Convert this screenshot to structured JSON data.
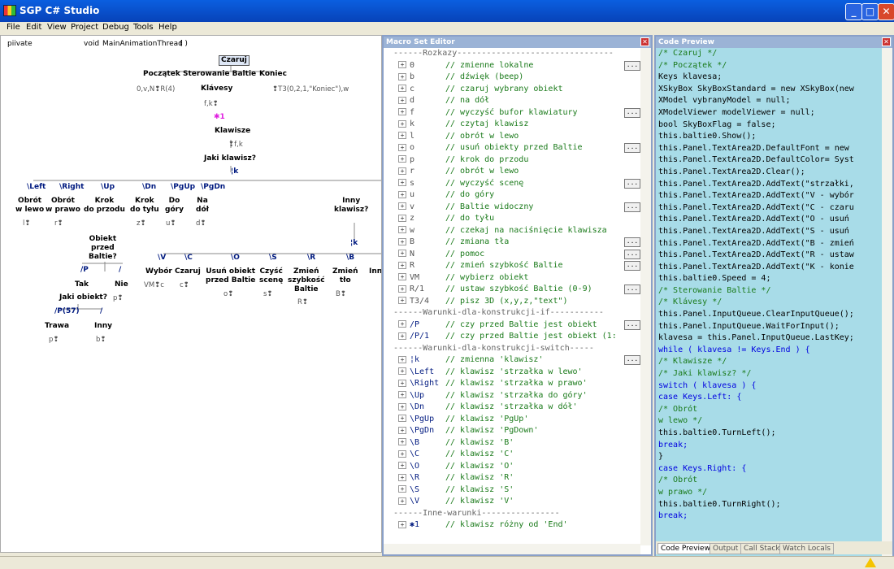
{
  "window": {
    "title": "SGP C# Studio",
    "min": "_",
    "max": "□",
    "close": "✕"
  },
  "menu": [
    "File",
    "Edit",
    "View",
    "Project",
    "Debug",
    "Tools",
    "Help"
  ],
  "diagram": {
    "header": {
      "visibility": "piivate",
      "type": "void",
      "name": "MainAnimationThread",
      "parens": "(        )"
    },
    "nodes": [
      {
        "id": "czaruj",
        "text": "Czaruj",
        "style": "nb"
      },
      {
        "id": "poczatek",
        "text": "Początek",
        "style": "nb"
      },
      {
        "id": "sterowanie",
        "text": "Sterowanie Baltie",
        "style": "nb"
      },
      {
        "id": "koniec",
        "text": "Koniec",
        "style": "nb"
      },
      {
        "id": "g-poczatek",
        "text": "0,v,N❢R(4)",
        "style": "ng"
      },
      {
        "id": "klavesy",
        "text": "Klávesy",
        "style": "nb"
      },
      {
        "id": "g-koniec",
        "text": "❢T3(0,2,1,\"Koniec\"),w",
        "style": "ng"
      },
      {
        "id": "g-fk",
        "text": "f,k❢",
        "style": "ng"
      },
      {
        "id": "m1",
        "text": "✱1",
        "style": "nm"
      },
      {
        "id": "klawisze",
        "text": "Klawisze",
        "style": "nb"
      },
      {
        "id": "g-fk2",
        "text": "❢f,k",
        "style": "ng"
      },
      {
        "id": "jaki-klawisz",
        "text": "Jaki klawisz?",
        "style": "nb"
      },
      {
        "id": "k-var",
        "text": "¦k",
        "style": "nl"
      },
      {
        "id": "c-left",
        "text": "\\Left",
        "style": "nl"
      },
      {
        "id": "c-right",
        "text": "\\Right",
        "style": "nl"
      },
      {
        "id": "c-up",
        "text": "\\Up",
        "style": "nl"
      },
      {
        "id": "c-dn",
        "text": "\\Dn",
        "style": "nl"
      },
      {
        "id": "c-pgup",
        "text": "\\PgUp",
        "style": "nl"
      },
      {
        "id": "c-pgdn",
        "text": "\\PgDn",
        "style": "nl"
      },
      {
        "id": "a-obrot-l",
        "text": "Obrót\nw lewo",
        "style": "nb"
      },
      {
        "id": "a-obrot-p",
        "text": "Obrót\nw prawo",
        "style": "nb"
      },
      {
        "id": "a-krok-p",
        "text": "Krok\ndo przodu",
        "style": "nb"
      },
      {
        "id": "a-krok-t",
        "text": "Krok\ndo tyłu",
        "style": "nb"
      },
      {
        "id": "a-do-gory",
        "text": "Do\ngóry",
        "style": "nb"
      },
      {
        "id": "a-na-dol",
        "text": "Na\ndół",
        "style": "nb"
      },
      {
        "id": "a-inny",
        "text": "Inny\nklawisz?",
        "style": "nb"
      },
      {
        "id": "g-l",
        "text": "l❢",
        "style": "ng"
      },
      {
        "id": "g-r",
        "text": "r❢",
        "style": "ng"
      },
      {
        "id": "g-z",
        "text": "z❢",
        "style": "ng"
      },
      {
        "id": "g-u",
        "text": "u❢",
        "style": "ng"
      },
      {
        "id": "g-d",
        "text": "d❢",
        "style": "ng"
      },
      {
        "id": "obiekt-q",
        "text": "Obiekt\nprzed\nBaltie?",
        "style": "nb"
      },
      {
        "id": "k-var2",
        "text": "¦k",
        "style": "nl"
      },
      {
        "id": "c-p",
        "text": "/P",
        "style": "nl"
      },
      {
        "id": "c-slash",
        "text": "/",
        "style": "nl"
      },
      {
        "id": "c-v",
        "text": "\\V",
        "style": "nl"
      },
      {
        "id": "c-c",
        "text": "\\C",
        "style": "nl"
      },
      {
        "id": "c-o",
        "text": "\\O",
        "style": "nl"
      },
      {
        "id": "c-s",
        "text": "\\S",
        "style": "nl"
      },
      {
        "id": "c-r",
        "text": "\\R",
        "style": "nl"
      },
      {
        "id": "c-b",
        "text": "\\B",
        "style": "nl"
      },
      {
        "id": "tak",
        "text": "Tak",
        "style": "nb"
      },
      {
        "id": "nie",
        "text": "Nie",
        "style": "nb"
      },
      {
        "id": "jaki-obiekt",
        "text": "Jaki obiekt?",
        "style": "nb"
      },
      {
        "id": "g-p",
        "text": "p❢",
        "style": "ng"
      },
      {
        "id": "a-wybor",
        "text": "Wybór",
        "style": "nb"
      },
      {
        "id": "a-czaruj",
        "text": "Czaruj",
        "style": "nb"
      },
      {
        "id": "a-usun",
        "text": "Usuń obiekt\nprzed Baltie",
        "style": "nb"
      },
      {
        "id": "a-czysc",
        "text": "Czyść\nscenę",
        "style": "nb"
      },
      {
        "id": "a-zmien-s",
        "text": "Zmień\nszybkość\nBaltie",
        "style": "nb"
      },
      {
        "id": "a-zmien-t",
        "text": "Zmień\ntło",
        "style": "nb"
      },
      {
        "id": "a-inn",
        "text": "Inny",
        "style": "nb"
      },
      {
        "id": "g-vm",
        "text": "VM❢c",
        "style": "ng"
      },
      {
        "id": "g-c",
        "text": "c❢",
        "style": "ng"
      },
      {
        "id": "g-o",
        "text": "o❢",
        "style": "ng"
      },
      {
        "id": "g-s",
        "text": "s❢",
        "style": "ng"
      },
      {
        "id": "g-R",
        "text": "R❢",
        "style": "ng"
      },
      {
        "id": "g-B",
        "text": "B❢",
        "style": "ng"
      },
      {
        "id": "c-p57",
        "text": "/P(57)",
        "style": "nl"
      },
      {
        "id": "c-slash2",
        "text": "/",
        "style": "nl"
      },
      {
        "id": "trawa",
        "text": "Trawa",
        "style": "nb"
      },
      {
        "id": "inny2",
        "text": "Inny",
        "style": "nb"
      },
      {
        "id": "g-p2",
        "text": "p❢",
        "style": "ng"
      },
      {
        "id": "g-b2",
        "text": "b❢",
        "style": "ng"
      }
    ]
  },
  "macro_editor": {
    "title": "Macro Set Editor",
    "rows": [
      {
        "t": "sec",
        "text": "------Rozkazy--------------------------------"
      },
      {
        "t": "row",
        "key": "0",
        "comment": "// zmienne lokalne",
        "dots": true
      },
      {
        "t": "row",
        "key": "b",
        "comment": "// dźwięk (beep)"
      },
      {
        "t": "row",
        "key": "c",
        "comment": "// czaruj wybrany obiekt"
      },
      {
        "t": "row",
        "key": "d",
        "comment": "// na dół"
      },
      {
        "t": "row",
        "key": "f",
        "comment": "// wyczyść bufor klawiatury",
        "dots": true
      },
      {
        "t": "row",
        "key": "k",
        "comment": "// czytaj klawisz"
      },
      {
        "t": "row",
        "key": "l",
        "comment": "// obrót w lewo"
      },
      {
        "t": "row",
        "key": "o",
        "comment": "// usuń obiekty przed Baltie",
        "dots": true
      },
      {
        "t": "row",
        "key": "p",
        "comment": "// krok do przodu"
      },
      {
        "t": "row",
        "key": "r",
        "comment": "// obrót w lewo"
      },
      {
        "t": "row",
        "key": "s",
        "comment": "// wyczyść scenę",
        "dots": true
      },
      {
        "t": "row",
        "key": "u",
        "comment": "// do góry"
      },
      {
        "t": "row",
        "key": "v",
        "comment": "// Baltie widoczny",
        "dots": true
      },
      {
        "t": "row",
        "key": "z",
        "comment": "// do tyłu"
      },
      {
        "t": "row",
        "key": "w",
        "comment": "// czekaj na naciśnięcie klawisza"
      },
      {
        "t": "row",
        "key": "B",
        "comment": "// zmiana tła",
        "dots": true
      },
      {
        "t": "row",
        "key": "N",
        "comment": "// pomoc",
        "dots": true
      },
      {
        "t": "row",
        "key": "R",
        "comment": "// zmień szybkość Baltie",
        "dots": true
      },
      {
        "t": "row",
        "key": "VM",
        "comment": "// wybierz obiekt"
      },
      {
        "t": "row",
        "key": "R/1",
        "comment": "// ustaw szybkość Baltie (0-9)",
        "dots": true
      },
      {
        "t": "row",
        "key": "T3/4",
        "comment": "// pisz 3D (x,y,z,\"text\")"
      },
      {
        "t": "sec",
        "text": "------Warunki-dla-konstrukcji-if-----------"
      },
      {
        "t": "row",
        "key": "/P",
        "blue": true,
        "comment": "// czy przed Baltie jest obiekt",
        "dots": true
      },
      {
        "t": "row",
        "key": "/P/1",
        "blue": true,
        "comment": "// czy przed Baltie jest obiekt (1:"
      },
      {
        "t": "sec",
        "text": "------Warunki-dla-konstrukcji-switch-----"
      },
      {
        "t": "row",
        "key": "¦k",
        "blue": true,
        "comment": "// zmienna 'klawisz'",
        "dots": true
      },
      {
        "t": "row",
        "key": "\\Left",
        "blue": true,
        "comment": "// klawisz 'strzałka w lewo'"
      },
      {
        "t": "row",
        "key": "\\Right",
        "blue": true,
        "comment": "// klawisz 'strzałka w prawo'"
      },
      {
        "t": "row",
        "key": "\\Up",
        "blue": true,
        "comment": "// klawisz 'strzałka do góry'"
      },
      {
        "t": "row",
        "key": "\\Dn",
        "blue": true,
        "comment": "// klawisz 'strzałka w dół'"
      },
      {
        "t": "row",
        "key": "\\PgUp",
        "blue": true,
        "comment": "// klawisz 'PgUp'"
      },
      {
        "t": "row",
        "key": "\\PgDn",
        "blue": true,
        "comment": "// klawisz 'PgDown'"
      },
      {
        "t": "row",
        "key": "\\B",
        "blue": true,
        "comment": "// klawisz 'B'"
      },
      {
        "t": "row",
        "key": "\\C",
        "blue": true,
        "comment": "// klawisz 'C'"
      },
      {
        "t": "row",
        "key": "\\O",
        "blue": true,
        "comment": "// klawisz 'O'"
      },
      {
        "t": "row",
        "key": "\\R",
        "blue": true,
        "comment": "// klawisz 'R'"
      },
      {
        "t": "row",
        "key": "\\S",
        "blue": true,
        "comment": "// klawisz 'S'"
      },
      {
        "t": "row",
        "key": "\\V",
        "blue": true,
        "comment": "// klawisz 'V'"
      },
      {
        "t": "sec",
        "text": "------Inne-warunki----------------"
      },
      {
        "t": "row",
        "key": "✱1",
        "blue": true,
        "comment": "// klawisz różny od 'End'"
      }
    ]
  },
  "code_preview": {
    "title": "Code Preview",
    "lines": [
      {
        "c": "ccm",
        "text": "/* Czaruj */"
      },
      {
        "c": "ccm",
        "text": "/* Początek */"
      },
      {
        "c": "ctx",
        "text": "Keys klavesa;"
      },
      {
        "c": "ctx",
        "text": "XSkyBox SkyBoxStandard = new XSkyBox(new"
      },
      {
        "c": "ctx",
        "text": "XModel vybranyModel = null;"
      },
      {
        "c": "ctx",
        "text": "XModelViewer modelViewer = null;"
      },
      {
        "c": "ctx",
        "text": "bool SkyBoxFlag = false;"
      },
      {
        "c": "ctx",
        "text": "this.baltie0.Show();"
      },
      {
        "c": "ctx",
        "text": "this.Panel.TextArea2D.DefaultFont = new"
      },
      {
        "c": "ctx",
        "text": "this.Panel.TextArea2D.DefaultColor= Syst"
      },
      {
        "c": "ctx",
        "text": "this.Panel.TextArea2D.Clear();"
      },
      {
        "c": "ctx",
        "text": "this.Panel.TextArea2D.AddText(\"strzałki,"
      },
      {
        "c": "ctx",
        "text": "this.Panel.TextArea2D.AddText(\"V - wybór"
      },
      {
        "c": "ctx",
        "text": "this.Panel.TextArea2D.AddText(\"C - czaru"
      },
      {
        "c": "ctx",
        "text": "this.Panel.TextArea2D.AddText(\"O - usuń"
      },
      {
        "c": "ctx",
        "text": "this.Panel.TextArea2D.AddText(\"S - usuń"
      },
      {
        "c": "ctx",
        "text": "this.Panel.TextArea2D.AddText(\"B - zmień"
      },
      {
        "c": "ctx",
        "text": "this.Panel.TextArea2D.AddText(\"R - ustaw"
      },
      {
        "c": "ctx",
        "text": "this.Panel.TextArea2D.AddText(\"K - konie"
      },
      {
        "c": "ctx",
        "text": "this.baltie0.Speed = 4;"
      },
      {
        "c": "ccm",
        "text": "/* Sterowanie Baltie */"
      },
      {
        "c": "ccm",
        "text": "/* Klávesy */"
      },
      {
        "c": "ctx",
        "text": "this.Panel.InputQueue.ClearInputQueue();"
      },
      {
        "c": "ctx",
        "text": "this.Panel.InputQueue.WaitForInput();"
      },
      {
        "c": "ctx",
        "text": "klavesa = this.Panel.InputQueue.LastKey;"
      },
      {
        "c": "ckw",
        "text": "while ( klavesa != Keys.End ) {"
      },
      {
        "c": "ccm",
        "text": "  /* Klawisze */"
      },
      {
        "c": "ccm",
        "text": "  /* Jaki klawisz? */"
      },
      {
        "c": "ckw",
        "text": "  switch ( klavesa        ) {"
      },
      {
        "c": "ckw",
        "text": "    case Keys.Left: {"
      },
      {
        "c": "ccm",
        "text": "      /* Obrót"
      },
      {
        "c": "ccm",
        "text": "      w lewo */"
      },
      {
        "c": "ctx",
        "text": "      this.baltie0.TurnLeft();"
      },
      {
        "c": "ckw",
        "text": "      break;"
      },
      {
        "c": "ctx",
        "text": "      }"
      },
      {
        "c": "ckw",
        "text": "    case Keys.Right: {"
      },
      {
        "c": "ccm",
        "text": "      /* Obrót"
      },
      {
        "c": "ccm",
        "text": "      w prawo */"
      },
      {
        "c": "ctx",
        "text": "      this.baltie0.TurnRight();"
      },
      {
        "c": "ckw",
        "text": "      break;"
      }
    ],
    "tabs": [
      "Code Preview",
      "Output",
      "Call Stack",
      "Watch Locals"
    ]
  },
  "colors": {
    "titlebar": "#0a5fe0",
    "code_bg": "#a8dce8",
    "comment": "#1a7a1a",
    "keyword": "#0000e0",
    "case_label": "#001a80"
  },
  "icons": {
    "app": "sgp-app-icon",
    "warning": "warning-icon",
    "expand": "expand-icon"
  }
}
